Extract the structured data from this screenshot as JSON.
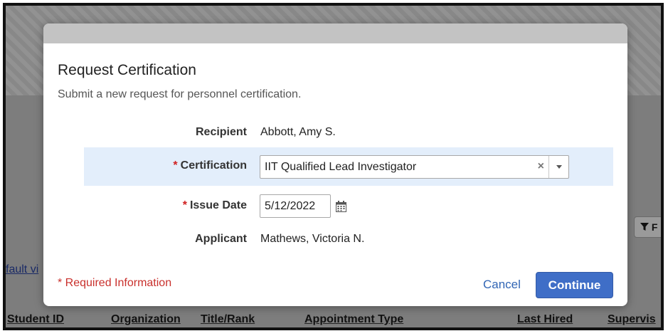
{
  "background": {
    "link_text": "fault vi",
    "filter_button": "F",
    "table_columns": [
      "Student ID",
      "Organization",
      "Title/Rank",
      "Appointment Type",
      "Last Hired",
      "Supervis"
    ]
  },
  "modal": {
    "title": "Request Certification",
    "subtitle": "Submit a new request for personnel certification.",
    "fields": {
      "recipient": {
        "label": "Recipient",
        "value": "Abbott, Amy S."
      },
      "certification": {
        "label": "Certification",
        "required": true,
        "value": "IIT Qualified Lead Investigator"
      },
      "issue_date": {
        "label": "Issue Date",
        "required": true,
        "value": "5/12/2022"
      },
      "applicant": {
        "label": "Applicant",
        "value": "Mathews, Victoria N."
      }
    },
    "required_marker": "*",
    "clear_glyph": "×",
    "required_info": "* Required Information",
    "cancel_label": "Cancel",
    "continue_label": "Continue"
  },
  "colors": {
    "accent": "#3f6ec7",
    "link": "#3266b5",
    "required": "#d02020",
    "highlight_row": "#e3eefb"
  },
  "icons": {
    "calendar": "calendar-icon",
    "clear": "clear-icon",
    "dropdown": "chevron-down-icon",
    "filter": "filter-icon"
  }
}
